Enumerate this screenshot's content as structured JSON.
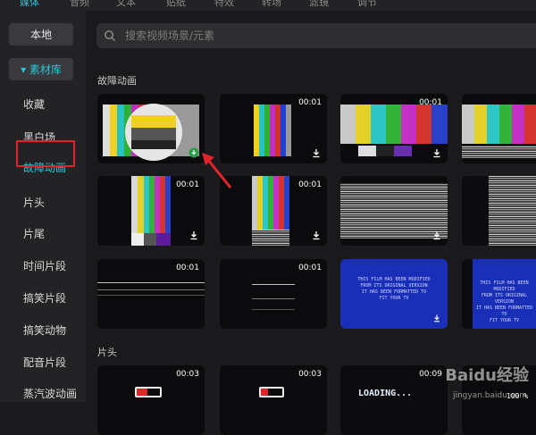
{
  "topnav": {
    "items": [
      "媒体",
      "音频",
      "文本",
      "贴纸",
      "特效",
      "转场",
      "滤镜",
      "调节"
    ],
    "active_index": 0
  },
  "sidebar": {
    "local_label": "本地",
    "library_label": "▾ 素材库",
    "items": [
      {
        "label": "收藏"
      },
      {
        "label": "黑白场"
      },
      {
        "label": "故障动画",
        "selected": true
      },
      {
        "label": "片头"
      },
      {
        "label": "片尾"
      },
      {
        "label": "时间片段"
      },
      {
        "label": "搞笑片段"
      },
      {
        "label": "搞笑动物"
      },
      {
        "label": "配音片段"
      },
      {
        "label": "蒸汽波动画"
      }
    ]
  },
  "search": {
    "placeholder": "搜索视频场景/元素"
  },
  "sections": {
    "glitch": {
      "title": "故障动画",
      "tiles": [
        {
          "duration": "",
          "kind": "test-card"
        },
        {
          "duration": "00:01",
          "kind": "test-card-small"
        },
        {
          "duration": "00:01",
          "kind": "color-bars"
        },
        {
          "duration": "",
          "kind": "color-bars-partial"
        },
        {
          "duration": "00:01",
          "kind": "vertical-bars"
        },
        {
          "duration": "00:01",
          "kind": "vertical-bars-2"
        },
        {
          "duration": "",
          "kind": "static-noise"
        },
        {
          "duration": "",
          "kind": "static-noise-partial"
        },
        {
          "duration": "00:01",
          "kind": "scanline"
        },
        {
          "duration": "00:01",
          "kind": "scanline-2"
        },
        {
          "duration": "",
          "kind": "blue-screen"
        },
        {
          "duration": "",
          "kind": "blue-screen-partial"
        }
      ]
    },
    "intro": {
      "title": "片头",
      "tiles": [
        {
          "duration": "00:03"
        },
        {
          "duration": "00:03"
        },
        {
          "duration": "00:09"
        },
        {
          "duration": ""
        }
      ]
    }
  },
  "blue_screen_text": [
    "THIS FILM HAS BEEN MODIFIED",
    "FROM ITS ORIGINAL VERSION",
    "IT HAS BEEN FORMATTED TO",
    "FIT YOUR TV"
  ],
  "intro_tile_texts": {
    "loading": "LOADING...",
    "percent": "100 %"
  },
  "watermark": {
    "brand": "Baidu经验",
    "url": "jingyan.baidu.com"
  },
  "colors": {
    "accent": "#29c6d6",
    "highlight_border": "#e0252a",
    "arrow": "#e0252a"
  }
}
